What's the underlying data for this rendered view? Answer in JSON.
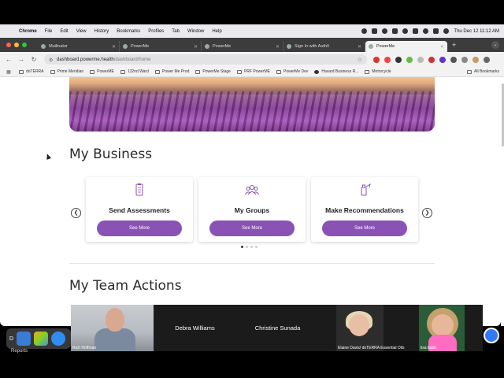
{
  "menubar": {
    "app": "Chrome",
    "items": [
      "File",
      "Edit",
      "View",
      "History",
      "Bookmarks",
      "Profiles",
      "Tab",
      "Window",
      "Help"
    ],
    "clock": "Thu Dec 12  11:12 AM"
  },
  "tabs": [
    {
      "title": "Mailinator",
      "active": false
    },
    {
      "title": "PowerMe",
      "active": false
    },
    {
      "title": "PowerMe",
      "active": false
    },
    {
      "title": "Sign In with Auth0",
      "active": false
    },
    {
      "title": "PowerMe",
      "active": true
    }
  ],
  "toolbar": {
    "url_host": "dashboard.powerme.health",
    "url_path": "/dashboard/home"
  },
  "bookmarks": [
    "doTERRA",
    "Prime Meridian",
    "PowerME",
    "132nd Ward",
    "Power Me Prod",
    "PowerMe Stage",
    "PRF PowerME",
    "PowerMe Dev",
    "Havard Business R...",
    "Motorcycle"
  ],
  "bookmarks_all": "All Bookmarks",
  "page": {
    "business_heading": "My Business",
    "team_heading": "My Team Actions",
    "cards": [
      {
        "title": "Send Assessments",
        "button": "See More",
        "icon": "clipboard-icon"
      },
      {
        "title": "My Groups",
        "button": "See More",
        "icon": "group-icon"
      },
      {
        "title": "Make Recommendations",
        "button": "See More",
        "icon": "bottle-icon"
      }
    ],
    "carousel": {
      "pages": 4,
      "current": 1
    }
  },
  "video_call": {
    "participants": [
      {
        "name": "Rich Hoffman",
        "label_position": "corner"
      },
      {
        "name": "Debra Williams",
        "label_position": "center"
      },
      {
        "name": "Christine Sunada",
        "label_position": "center"
      },
      {
        "name": "Elaine Davis/ doTERRA Essential Oils",
        "label_position": "corner"
      },
      {
        "name": "lisa babb",
        "label_position": "corner"
      }
    ]
  },
  "dock": {
    "label": "Reports",
    "letter": "D"
  },
  "colors": {
    "accent": "#8a52b4",
    "chrome_dark": "#3c3c3c"
  }
}
